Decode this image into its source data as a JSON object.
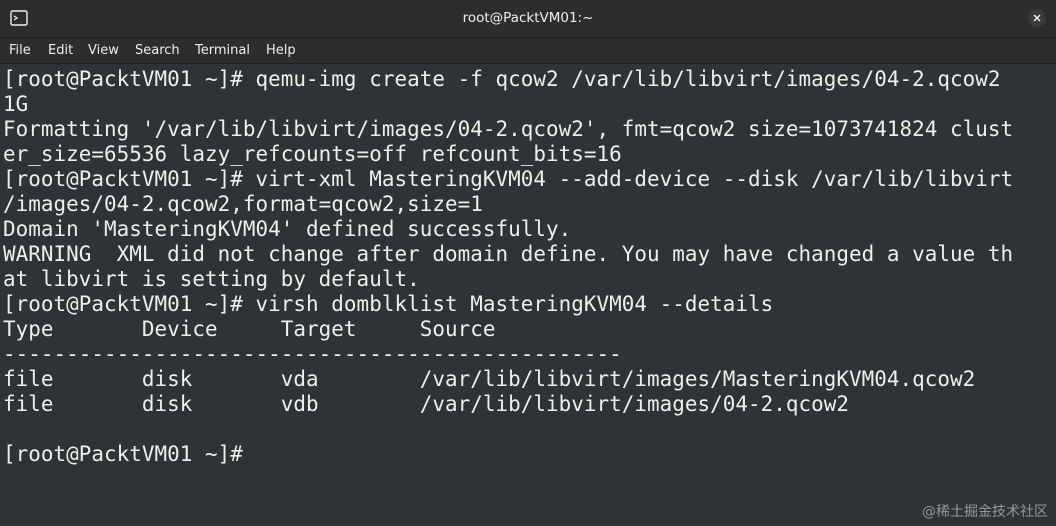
{
  "window": {
    "title": "root@PacktVM01:~"
  },
  "menu": {
    "items": [
      "File",
      "Edit",
      "View",
      "Search",
      "Terminal",
      "Help"
    ]
  },
  "terminal": {
    "lines": [
      "[root@PacktVM01 ~]# qemu-img create -f qcow2 /var/lib/libvirt/images/04-2.qcow2",
      "1G",
      "Formatting '/var/lib/libvirt/images/04-2.qcow2', fmt=qcow2 size=1073741824 clust",
      "er_size=65536 lazy_refcounts=off refcount_bits=16",
      "[root@PacktVM01 ~]# virt-xml MasteringKVM04 --add-device --disk /var/lib/libvirt",
      "/images/04-2.qcow2,format=qcow2,size=1",
      "Domain 'MasteringKVM04' defined successfully.",
      "WARNING  XML did not change after domain define. You may have changed a value th",
      "at libvirt is setting by default.",
      "[root@PacktVM01 ~]# virsh domblklist MasteringKVM04 --details",
      "Type       Device     Target     Source",
      "-------------------------------------------------",
      "file       disk       vda        /var/lib/libvirt/images/MasteringKVM04.qcow2",
      "file       disk       vdb        /var/lib/libvirt/images/04-2.qcow2",
      "",
      "[root@PacktVM01 ~]#"
    ]
  },
  "watermark": "@稀土掘金技术社区",
  "colors": {
    "terminal_bg": "#2e3436",
    "terminal_fg": "#eeeeec",
    "chrome_bg": "#2d2d2d"
  }
}
